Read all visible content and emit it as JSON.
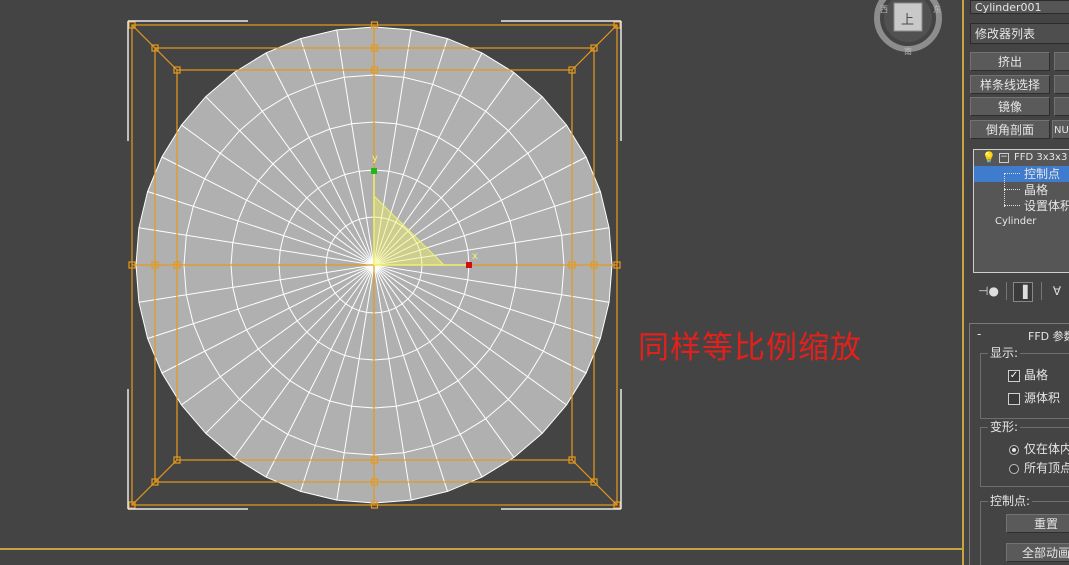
{
  "annotation": {
    "text": "同样等比例缩放"
  },
  "viewport": {
    "axis_y": "y",
    "axis_x": "x",
    "colors": {
      "background": "#444444",
      "mesh_fill": "#b0b0b0",
      "wire": "#ffffff",
      "lattice": "#e69a1c",
      "y_handle": "#1eb81e",
      "x_handle": "#d01010",
      "gizmo": "#f2f26b"
    }
  },
  "viewcube": {
    "label": "上"
  },
  "panel": {
    "object_name": "Cylinder001",
    "modifier_list": "修改器列表",
    "buttons": [
      {
        "label": "挤出"
      },
      {
        "label": "样条线选择"
      },
      {
        "label": "镜像"
      },
      {
        "label": "倒角剖面"
      }
    ],
    "side_button": "NU",
    "stack": {
      "modifier": "FFD 3x3x3",
      "sub_items": [
        {
          "label": "控制点",
          "selected": true
        },
        {
          "label": "晶格",
          "selected": false
        },
        {
          "label": "设置体积",
          "selected": false
        }
      ],
      "base_object": "Cylinder"
    },
    "tool_icons": [
      {
        "icon": "pin-stack-icon"
      },
      {
        "icon": "show-end-result-icon"
      },
      {
        "icon": "make-unique-icon"
      }
    ],
    "rollout": {
      "collapse": "-",
      "title": "FFD 参数",
      "display_label": "显示:",
      "lattice_check": {
        "label": "晶格",
        "checked": true
      },
      "source_volume_check": {
        "label": "源体积",
        "checked": false
      },
      "deform_label": "变形:",
      "only_in_volume": {
        "label": "仅在体内",
        "selected": true
      },
      "all_vertices": {
        "label": "所有顶点",
        "selected": false
      },
      "control_points_label": "控制点:",
      "reset_button": "重置",
      "animate_all_button": "全部动画"
    }
  }
}
